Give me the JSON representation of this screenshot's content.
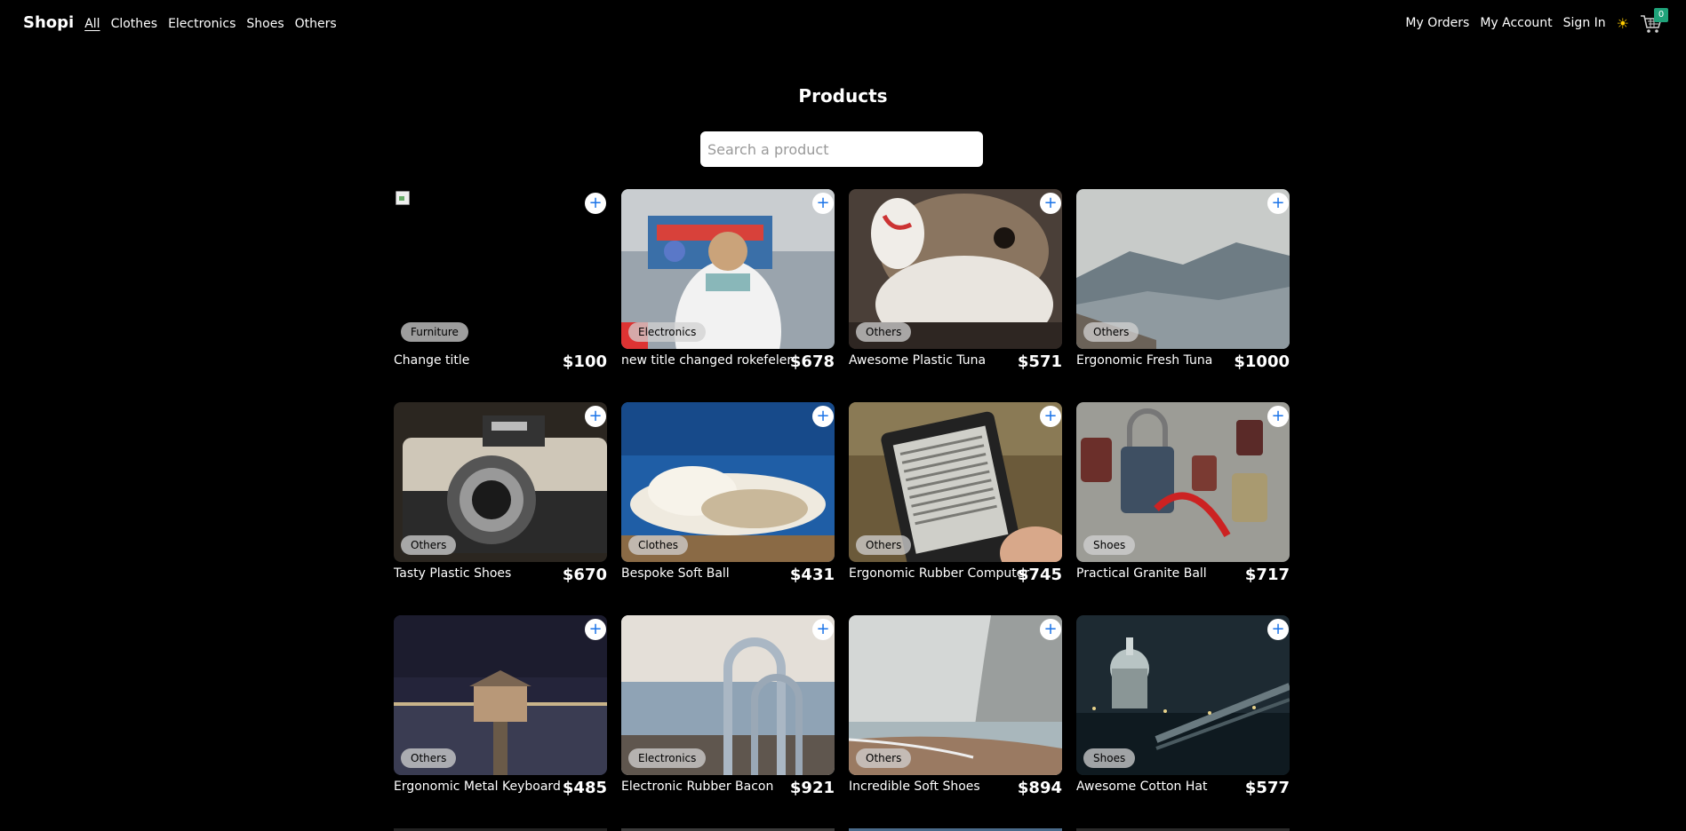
{
  "nav": {
    "brand": "Shopi",
    "categories": [
      {
        "label": "All",
        "active": true
      },
      {
        "label": "Clothes",
        "active": false
      },
      {
        "label": "Electronics",
        "active": false
      },
      {
        "label": "Shoes",
        "active": false
      },
      {
        "label": "Others",
        "active": false
      }
    ],
    "right": {
      "my_orders": "My Orders",
      "my_account": "My Account",
      "sign_in": "Sign In",
      "theme_icon": "sun-icon",
      "cart_icon": "cart-icon",
      "cart_count": "0"
    }
  },
  "page": {
    "title": "Products",
    "search_placeholder": "Search a product"
  },
  "products": [
    {
      "title": "Change title",
      "category": "Furniture",
      "price": "$100",
      "image": "broken"
    },
    {
      "title": "new title changed rokefeler",
      "category": "Electronics",
      "price": "$678",
      "image": "street-backpack"
    },
    {
      "title": "Awesome Plastic Tuna",
      "category": "Others",
      "price": "$571",
      "image": "bulldog"
    },
    {
      "title": "Ergonomic Fresh Tuna",
      "category": "Others",
      "price": "$1000",
      "image": "mountain-valley"
    },
    {
      "title": "Tasty Plastic Shoes",
      "category": "Others",
      "price": "$670",
      "image": "vintage-camera"
    },
    {
      "title": "Bespoke Soft Ball",
      "category": "Clothes",
      "price": "$431",
      "image": "clouds-sky"
    },
    {
      "title": "Ergonomic Rubber Computer",
      "category": "Others",
      "price": "$745",
      "image": "e-reader"
    },
    {
      "title": "Practical Granite Ball",
      "category": "Shoes",
      "price": "$717",
      "image": "padlocks"
    },
    {
      "title": "Ergonomic Metal Keyboard",
      "category": "Others",
      "price": "$485",
      "image": "boathouse-night"
    },
    {
      "title": "Electronic Rubber Bacon",
      "category": "Electronics",
      "price": "$921",
      "image": "pool-ladder"
    },
    {
      "title": "Incredible Soft Shoes",
      "category": "Others",
      "price": "$894",
      "image": "cliff-beach"
    },
    {
      "title": "Awesome Cotton Hat",
      "category": "Shoes",
      "price": "$577",
      "image": "city-night-dome"
    }
  ],
  "icons": {
    "add": "plus-icon"
  },
  "colors": {
    "background": "#000000",
    "accent": "#1a73e8",
    "badge": "#1fa37a"
  }
}
